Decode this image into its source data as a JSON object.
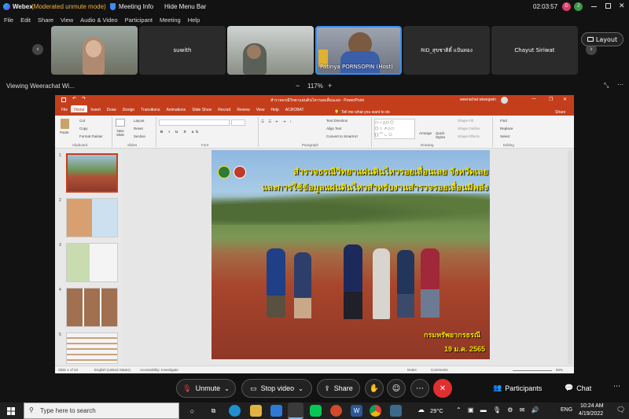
{
  "app": {
    "name": "Webex",
    "mode": "(Moderated unmute mode)",
    "meeting_info": "Meeting Info",
    "hide_menu": "Hide Menu Bar",
    "timer": "02:03:57"
  },
  "menu": [
    "File",
    "Edit",
    "Share",
    "View",
    "Audio & Video",
    "Participant",
    "Meeting",
    "Help"
  ],
  "participants": [
    {
      "name": ""
    },
    {
      "name": "suwith"
    },
    {
      "name": ""
    },
    {
      "name": "Patinya PORNSOPIN (Host)"
    },
    {
      "name": "RID_สุขชาติติ์ แป้นทอง"
    },
    {
      "name": "Chayut Siriwat"
    }
  ],
  "layout_label": "Layout",
  "viewing": {
    "text": "Viewing Weerachat Wi...",
    "zoom": "117%",
    "minus": "−",
    "plus": "+"
  },
  "ppt": {
    "doc_title": "สำรวจธรณีวิทยาแผ่นดินไหวรอยเลื่อนเลย - PowerPoint",
    "user": "weerachat wiwegwin",
    "tabs": [
      "File",
      "Home",
      "Insert",
      "Draw",
      "Design",
      "Transitions",
      "Animations",
      "Slide Show",
      "Record",
      "Review",
      "View",
      "Help",
      "ACROBAT"
    ],
    "tell_me": "Tell me what you want to do",
    "share": "Share",
    "clipboard": {
      "paste": "Paste",
      "cut": "Cut",
      "copy": "Copy",
      "format_painter": "Format Painter",
      "group": "Clipboard"
    },
    "slides": {
      "new_slide": "New Slide",
      "layout": "Layout",
      "reset": "Reset",
      "section": "Section",
      "group": "Slides"
    },
    "font_group": "Font",
    "paragraph": {
      "text_direction": "Text Direction",
      "align_text": "Align Text",
      "convert": "Convert to SmartArt",
      "group": "Paragraph"
    },
    "drawing": {
      "arrange": "Arrange",
      "quick_styles": "Quick Styles",
      "shape_fill": "Shape Fill",
      "shape_outline": "Shape Outline",
      "shape_effects": "Shape Effects",
      "group": "Drawing"
    },
    "editing": {
      "find": "Find",
      "replace": "Replace",
      "select": "Select",
      "group": "Editing"
    },
    "slide_numbers": [
      "1",
      "2",
      "3",
      "4",
      "5"
    ],
    "slide": {
      "title_line1": "สำรวจธรณีวิทยาแผ่นดินไหวรอยเลื่อนเลย จังหวัดเลย",
      "title_line2": "และการใช้ข้อมูลแผ่นดินไหวสำหรับงานสำรวจรอยเลื่อนมีพลัง",
      "dept": "กรมทรัพยากรธรณี",
      "date": "19 ม.ค. 2565"
    },
    "status": {
      "slide_of": "Slide 1 of 33",
      "language": "English (United States)",
      "accessibility": "Accessibility: Investigate",
      "notes": "Notes",
      "comments": "Comments",
      "zoom": "56%"
    }
  },
  "controls": {
    "unmute": "Unmute",
    "stop_video": "Stop video",
    "share": "Share",
    "participants": "Participants",
    "chat": "Chat"
  },
  "taskbar": {
    "search_placeholder": "Type here to search",
    "temp": "29°C",
    "lang": "ENG",
    "time": "10:24 AM",
    "date": "4/19/2022"
  },
  "colors": {
    "ppt_accent": "#c43e1c",
    "leave_red": "#e02f2f",
    "slide_title": "#f5e400"
  }
}
